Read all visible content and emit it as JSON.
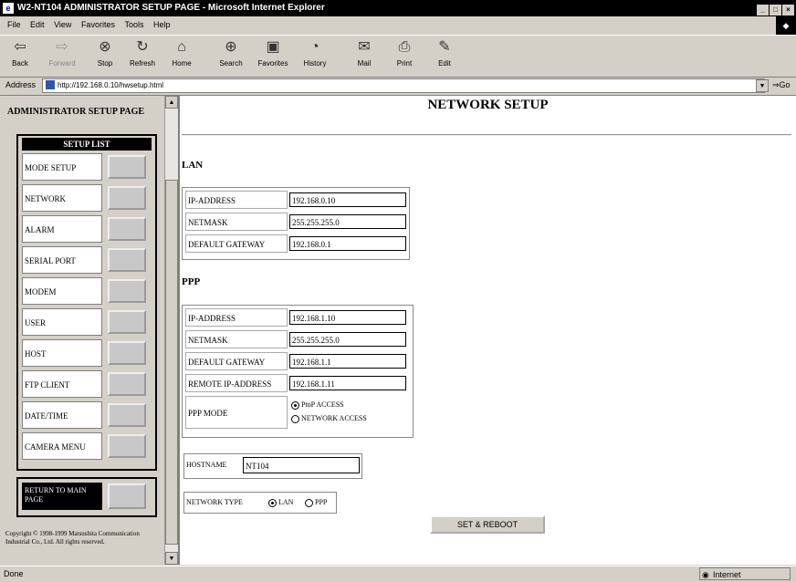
{
  "window": {
    "title": "W2-NT104 ADMINISTRATOR SETUP PAGE - Microsoft Internet Explorer"
  },
  "menu": [
    "File",
    "Edit",
    "View",
    "Favorites",
    "Tools",
    "Help"
  ],
  "toolbar": [
    {
      "label": "Back",
      "icon": "back-arrow-icon",
      "glyph": "⇦"
    },
    {
      "label": "Forward",
      "icon": "forward-arrow-icon",
      "glyph": "⇨"
    },
    {
      "label": "Stop",
      "icon": "stop-icon",
      "glyph": "⊗"
    },
    {
      "label": "Refresh",
      "icon": "refresh-icon",
      "glyph": "↻"
    },
    {
      "label": "Home",
      "icon": "home-icon",
      "glyph": "⌂"
    },
    {
      "label": "Search",
      "icon": "search-icon",
      "glyph": "⊕"
    },
    {
      "label": "Favorites",
      "icon": "favorites-icon",
      "glyph": "▣"
    },
    {
      "label": "History",
      "icon": "history-icon",
      "glyph": "◔"
    },
    {
      "label": "Mail",
      "icon": "mail-icon",
      "glyph": "✉"
    },
    {
      "label": "Print",
      "icon": "print-icon",
      "glyph": "⎙"
    },
    {
      "label": "Edit",
      "icon": "edit-icon",
      "glyph": "✎"
    }
  ],
  "address": {
    "label": "Address",
    "url": "http://192.168.0.10/hwsetup.html",
    "go": "Go"
  },
  "sidebar": {
    "header": "ADMINISTRATOR SETUP PAGE",
    "list_title": "SETUP LIST",
    "items": [
      "MODE SETUP",
      "NETWORK",
      "ALARM",
      "SERIAL PORT",
      "MODEM",
      "USER",
      "HOST",
      "FTP CLIENT",
      "DATE/TIME",
      "CAMERA MENU"
    ],
    "return_label": "RETURN TO MAIN PAGE",
    "copyright": "Copyright © 1998-1999 Matsushita Communication Industrial Co., Ltd. All rights reserved."
  },
  "page": {
    "title": "NETWORK SETUP",
    "lan": {
      "heading": "LAN",
      "fields": [
        {
          "label": "IP-ADDRESS",
          "value": "192.168.0.10"
        },
        {
          "label": "NETMASK",
          "value": "255.255.255.0"
        },
        {
          "label": "DEFAULT GATEWAY",
          "value": "192.168.0.1"
        }
      ]
    },
    "ppp": {
      "heading": "PPP",
      "fields": [
        {
          "label": "IP-ADDRESS",
          "value": "192.168.1.10"
        },
        {
          "label": "NETMASK",
          "value": "255.255.255.0"
        },
        {
          "label": "DEFAULT GATEWAY",
          "value": "192.168.1.1"
        },
        {
          "label": "REMOTE IP-ADDRESS",
          "value": "192.168.1.11"
        }
      ],
      "mode_label": "PPP MODE",
      "mode_options": [
        "PtoP ACCESS",
        "NETWORK ACCESS"
      ],
      "mode_selected": "PtoP ACCESS"
    },
    "hostname": {
      "label": "HOSTNAME",
      "value": "NT104"
    },
    "network_type": {
      "label": "NETWORK TYPE",
      "options": [
        "LAN",
        "PPP"
      ],
      "selected": "LAN"
    },
    "submit_label": "SET & REBOOT"
  },
  "status": {
    "text": "Done",
    "zone": "Internet"
  }
}
